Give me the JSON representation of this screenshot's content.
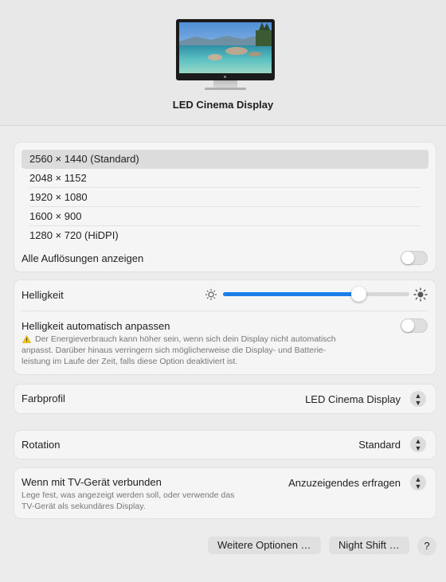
{
  "display": {
    "name": "LED Cinema Display"
  },
  "resolutions": {
    "items": [
      "2560 × 1440 (Standard)",
      "2048 × 1152",
      "1920 × 1080",
      "1600 × 900",
      "1280 × 720 (HiDPI)"
    ],
    "selected_index": 0,
    "show_all_label": "Alle Auflösungen anzeigen",
    "show_all_on": false
  },
  "brightness": {
    "label": "Helligkeit",
    "level": 0.73,
    "auto_label": "Helligkeit automatisch anpassen",
    "auto_on": false,
    "warning_icon": "warning-triangle-icon",
    "warning_text_lines": [
      "Der Energieverbrauch kann höher sein, wenn sich dein Display nicht automatisch",
      "anpasst. Darüber hinaus verringern sich möglicherweise die Display- und Batterie-",
      "leistung im Laufe der Zeit, falls diese Option deaktiviert ist."
    ]
  },
  "color_profile": {
    "label": "Farbprofil",
    "value": "LED Cinema Display"
  },
  "rotation": {
    "label": "Rotation",
    "value": "Standard"
  },
  "tv": {
    "label": "Wenn mit TV-Gerät verbunden",
    "value": "Anzuzeigendes erfragen",
    "note_lines": [
      "Lege fest, was angezeigt werden soll, oder verwende das",
      "TV-Gerät als sekundäres Display."
    ]
  },
  "buttons": {
    "more_options": "Weitere Optionen …",
    "night_shift": "Night Shift …",
    "help": "?"
  },
  "colors": {
    "accent": "#1a7fe8",
    "background": "#ececec",
    "card": "#f5f5f5"
  }
}
